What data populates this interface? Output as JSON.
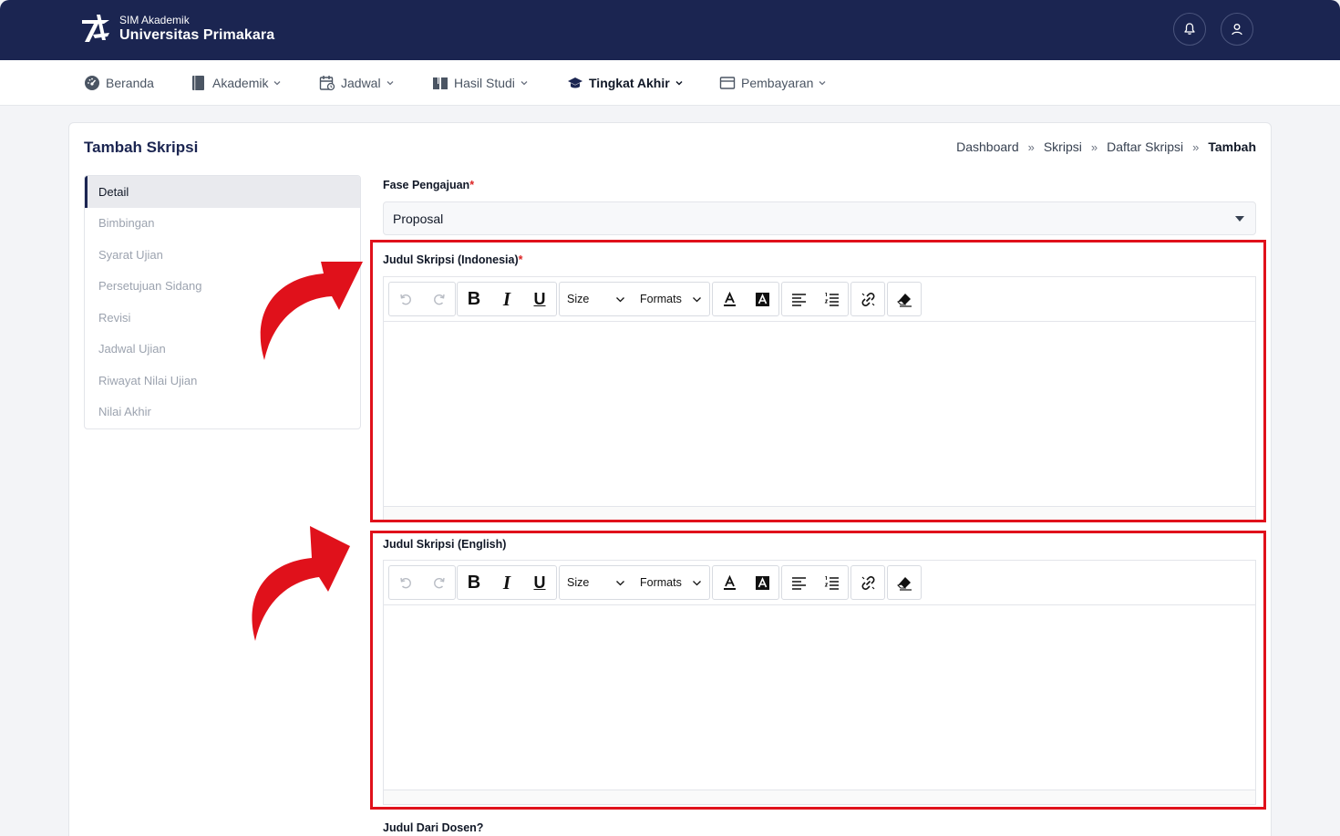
{
  "header": {
    "subtitle": "SIM Akademik",
    "title": "Universitas Primakara"
  },
  "nav": {
    "items": [
      {
        "label": "Beranda",
        "icon": "dashboard-icon"
      },
      {
        "label": "Akademik",
        "icon": "book-icon"
      },
      {
        "label": "Jadwal",
        "icon": "calendar-icon"
      },
      {
        "label": "Hasil Studi",
        "icon": "open-book-icon"
      },
      {
        "label": "Tingkat Akhir",
        "icon": "graduation-cap-icon",
        "active": true
      },
      {
        "label": "Pembayaran",
        "icon": "wallet-icon"
      }
    ]
  },
  "page": {
    "title": "Tambah Skripsi",
    "breadcrumb": [
      "Dashboard",
      "Skripsi",
      "Daftar Skripsi",
      "Tambah"
    ],
    "breadcrumb_sep": "»"
  },
  "sidemenu": {
    "items": [
      "Detail",
      "Bimbingan",
      "Syarat Ujian",
      "Persetujuan Sidang",
      "Revisi",
      "Jadwal Ujian",
      "Riwayat Nilai Ujian",
      "Nilai Akhir"
    ]
  },
  "form": {
    "fase_label": "Fase Pengajuan",
    "fase_value": "Proposal",
    "judul_id_label": "Judul Skripsi (Indonesia)",
    "judul_en_label": "Judul Skripsi (English)",
    "judul_dosen_label": "Judul Dari Dosen?",
    "required_mark": "*"
  },
  "toolbar": {
    "bold": "B",
    "italic": "I",
    "underline": "U",
    "size_label": "Size",
    "formats_label": "Formats"
  },
  "colors": {
    "header_bg": "#1b2551",
    "highlight": "#e0111b",
    "required": "#dc2626"
  }
}
